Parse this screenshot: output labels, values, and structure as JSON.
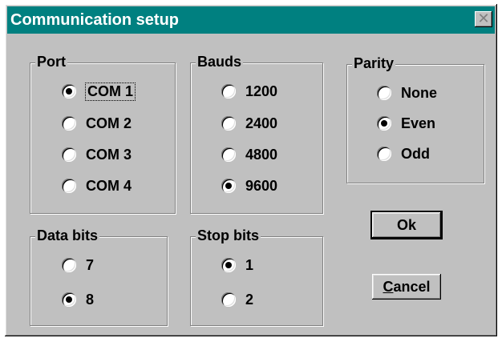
{
  "window": {
    "title": "Communication setup",
    "close_symbol": "✕"
  },
  "port": {
    "legend": "Port",
    "options": [
      {
        "label": "COM 1",
        "checked": true
      },
      {
        "label": "COM 2",
        "checked": false
      },
      {
        "label": "COM 3",
        "checked": false
      },
      {
        "label": "COM 4",
        "checked": false
      }
    ]
  },
  "bauds": {
    "legend": "Bauds",
    "options": [
      {
        "label": "1200",
        "checked": false
      },
      {
        "label": "2400",
        "checked": false
      },
      {
        "label": "4800",
        "checked": false
      },
      {
        "label": "9600",
        "checked": true
      }
    ]
  },
  "parity": {
    "legend": "Parity",
    "options": [
      {
        "label": "None",
        "checked": false
      },
      {
        "label": "Even",
        "checked": true
      },
      {
        "label": "Odd",
        "checked": false
      }
    ]
  },
  "data_bits": {
    "legend": "Data bits",
    "options": [
      {
        "label": "7",
        "checked": false
      },
      {
        "label": "8",
        "checked": true
      }
    ]
  },
  "stop_bits": {
    "legend": "Stop bits",
    "options": [
      {
        "label": "1",
        "checked": true
      },
      {
        "label": "2",
        "checked": false
      }
    ]
  },
  "buttons": {
    "ok": "Ok",
    "cancel_accel": "C",
    "cancel_rest": "ancel"
  }
}
